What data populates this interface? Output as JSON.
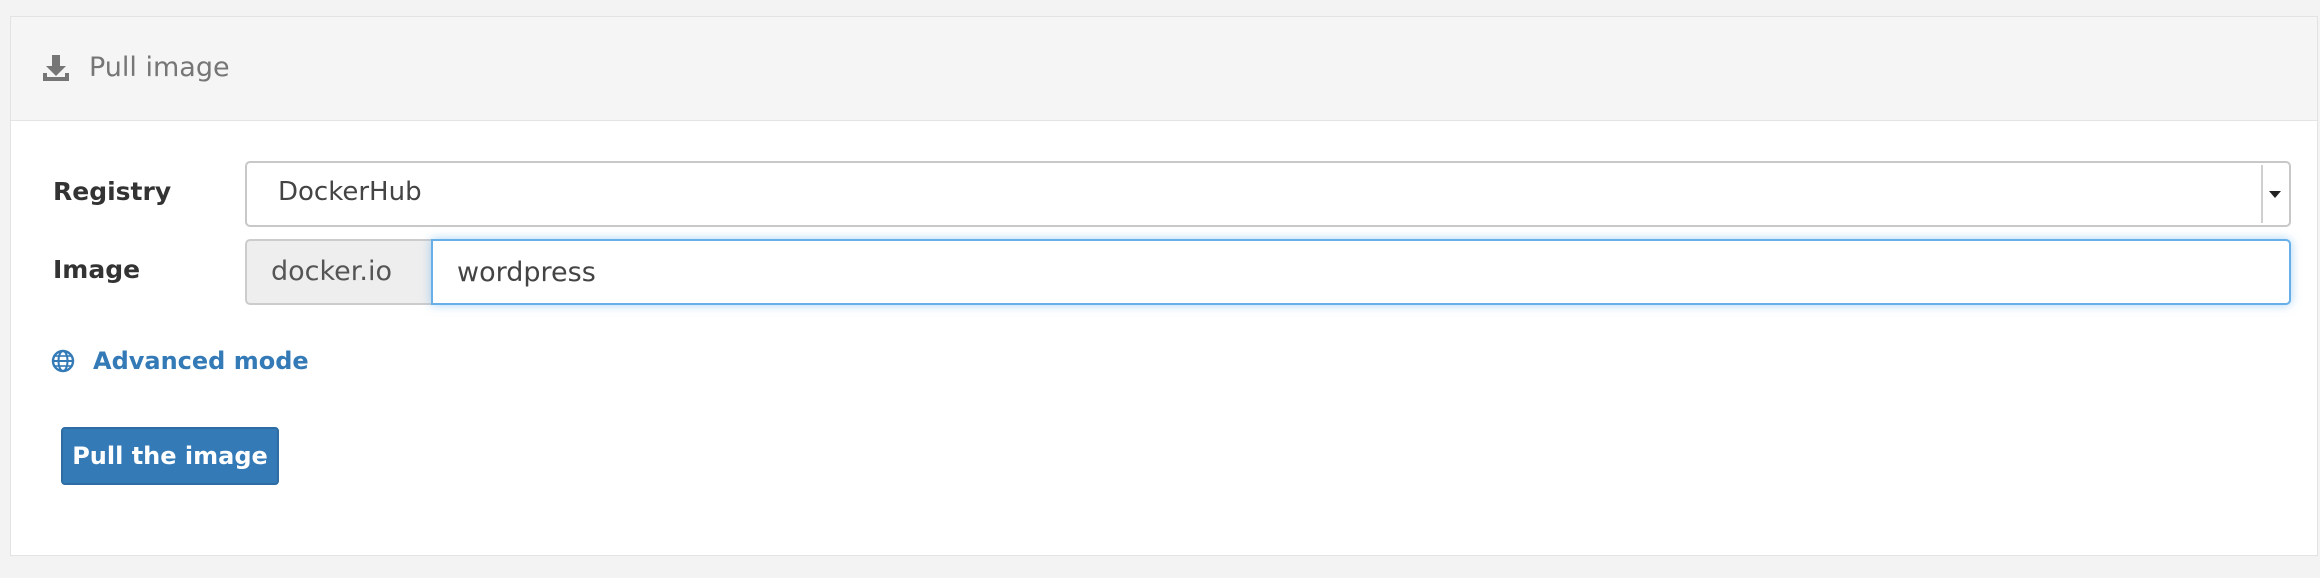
{
  "header": {
    "title": "Pull image",
    "icon": "download-icon"
  },
  "form": {
    "registry_label": "Registry",
    "registry_value": "DockerHub",
    "image_label": "Image",
    "image_prefix": "docker.io",
    "image_value": "wordpress"
  },
  "advanced": {
    "label": "Advanced mode",
    "icon": "globe-icon"
  },
  "actions": {
    "pull_label": "Pull the image"
  },
  "colors": {
    "accent": "#337ab7",
    "focus_border": "#66afe9",
    "addon_bg": "#eeeeee",
    "header_bg": "#f5f5f5"
  }
}
